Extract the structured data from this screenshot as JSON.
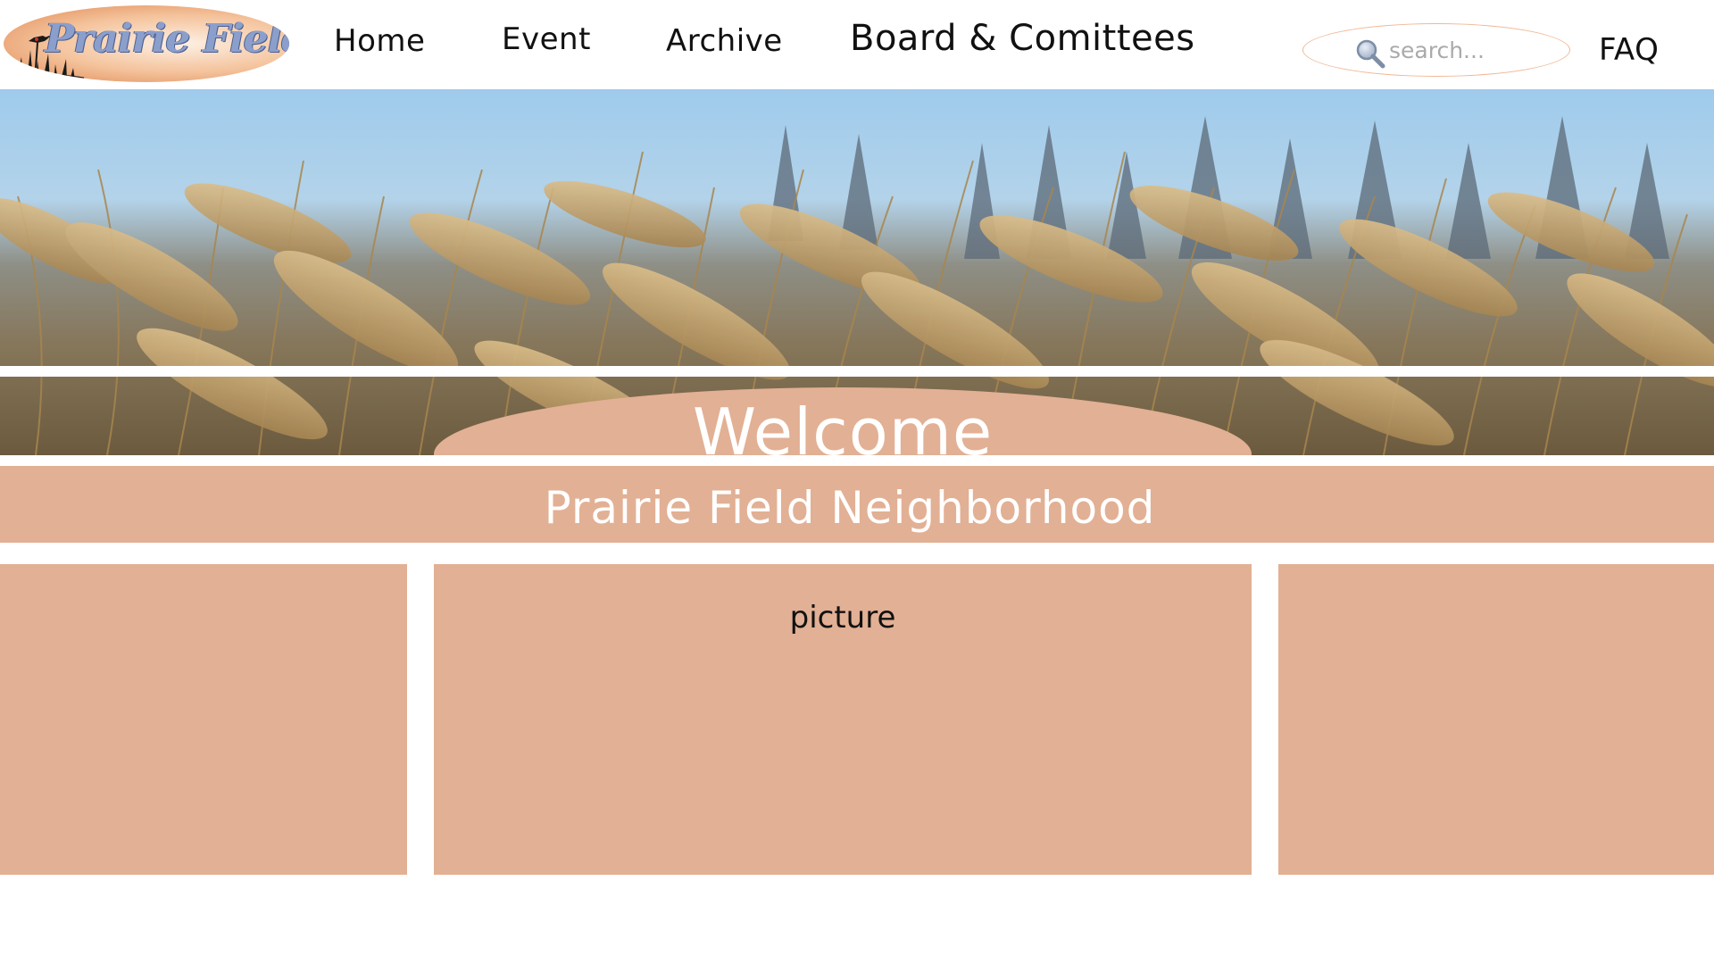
{
  "header": {
    "logo_text": "Prairie Fields",
    "nav": {
      "home": "Home",
      "event": "Event",
      "archive": "Archive",
      "board": "Board & Comittees",
      "faq": "FAQ"
    },
    "search": {
      "placeholder": "search...",
      "value": "",
      "icon": "magnifier-icon"
    }
  },
  "hero": {
    "welcome": "Welcome"
  },
  "title_band": {
    "title": "Prairie Field Neighborhood"
  },
  "panels": {
    "center_label": "picture"
  },
  "colors": {
    "accent": "#e2b094",
    "search_border": "#f0b896",
    "logo_text": "#8b9fcd",
    "sky": "#9ec8e8",
    "grass": "#c9a56c"
  }
}
